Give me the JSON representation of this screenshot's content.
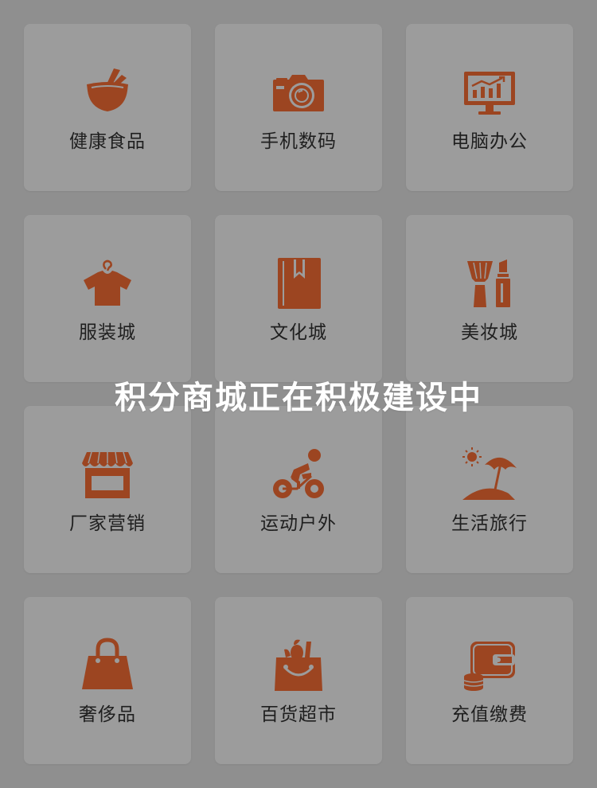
{
  "theme": {
    "icon_color": "#9c4521",
    "tile_bg": "#9c9c9c",
    "page_bg": "#8f8f8f",
    "label_color": "#1f1f1f",
    "overlay_text_color": "#ffffff"
  },
  "categories": [
    {
      "label": "健康食品",
      "icon": "bowl-chopsticks-icon"
    },
    {
      "label": "手机数码",
      "icon": "camera-icon"
    },
    {
      "label": "电脑办公",
      "icon": "monitor-chart-icon"
    },
    {
      "label": "服装城",
      "icon": "shirt-hanger-icon"
    },
    {
      "label": "文化城",
      "icon": "book-icon"
    },
    {
      "label": "美妆城",
      "icon": "makeup-brush-lipstick-icon"
    },
    {
      "label": "厂家营销",
      "icon": "storefront-icon"
    },
    {
      "label": "运动户外",
      "icon": "cyclist-icon"
    },
    {
      "label": "生活旅行",
      "icon": "beach-umbrella-icon"
    },
    {
      "label": "奢侈品",
      "icon": "handbag-icon"
    },
    {
      "label": "百货超市",
      "icon": "grocery-bag-icon"
    },
    {
      "label": "充值缴费",
      "icon": "wallet-coins-icon"
    }
  ],
  "overlay": {
    "message": "积分商城正在积极建设中"
  }
}
